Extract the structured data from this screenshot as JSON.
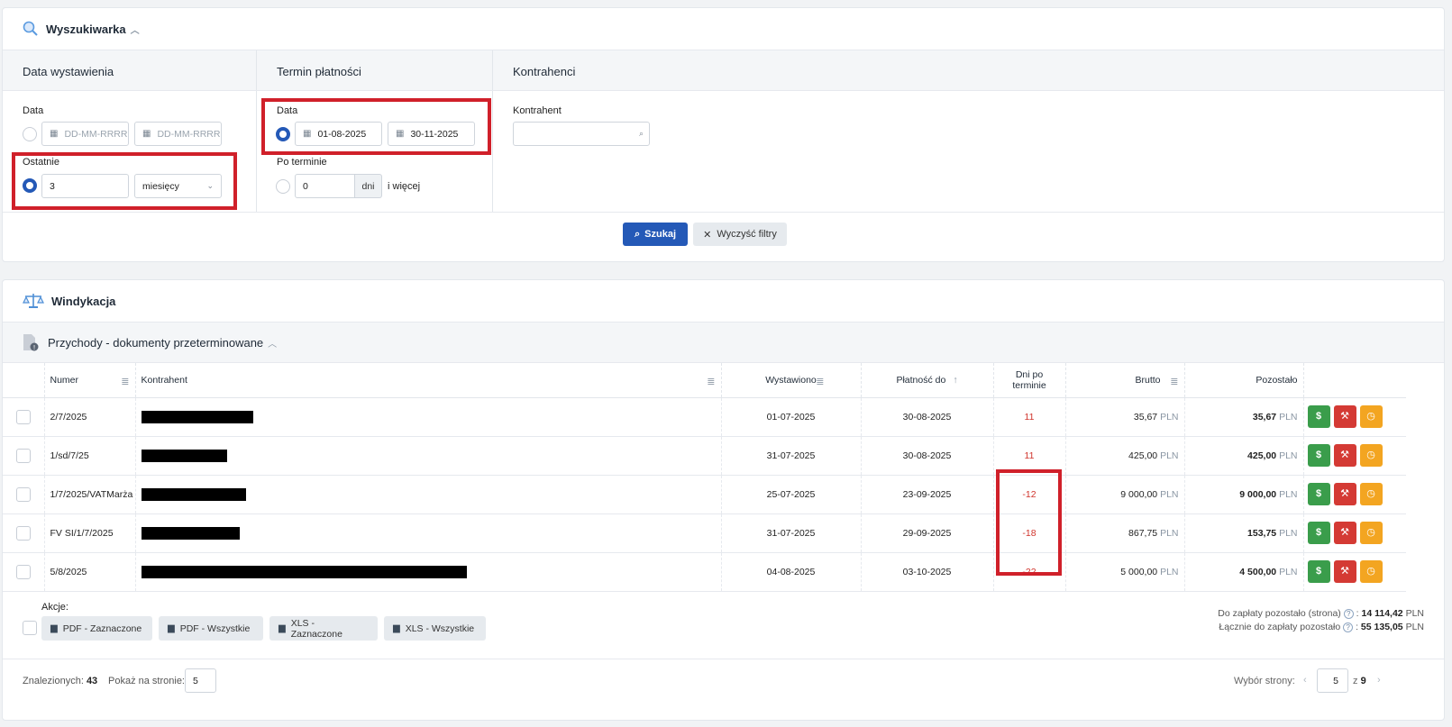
{
  "search": {
    "title": "Wyszukiwarka",
    "col1": {
      "title": "Data wystawienia",
      "date_label": "Data",
      "date_from_placeholder": "DD-MM-RRRR",
      "date_to_placeholder": "DD-MM-RRRR",
      "last_label": "Ostatnie",
      "last_value": "3",
      "last_unit": "miesięcy"
    },
    "col2": {
      "title": "Termin płatności",
      "date_label": "Data",
      "date_from": "01-08-2025",
      "date_to": "30-11-2025",
      "overdue_label": "Po terminie",
      "overdue_value": "0",
      "overdue_unit": "dni",
      "overdue_suffix": "i więcej"
    },
    "col3": {
      "title": "Kontrahenci",
      "contractor_label": "Kontrahent"
    },
    "search_button": "Szukaj",
    "clear_button": "Wyczyść filtry"
  },
  "windykacja": {
    "title": "Windykacja",
    "section_title": "Przychody - dokumenty przeterminowane",
    "columns": [
      "Numer",
      "Kontrahent",
      "Wystawiono",
      "Płatność do",
      "Dni po terminie",
      "Brutto",
      "Pozostało"
    ],
    "rows": [
      {
        "numer": "2/7/2025",
        "redact_w": 124,
        "wystawiono": "01-07-2025",
        "platnosc": "30-08-2025",
        "dni": "11",
        "brutto": "35,67",
        "pozostalo": "35,67"
      },
      {
        "numer": "1/sd/7/25",
        "redact_w": 95,
        "wystawiono": "31-07-2025",
        "platnosc": "30-08-2025",
        "dni": "11",
        "brutto": "425,00",
        "pozostalo": "425,00"
      },
      {
        "numer": "1/7/2025/VATMarża",
        "redact_w": 116,
        "wystawiono": "25-07-2025",
        "platnosc": "23-09-2025",
        "dni": "-12",
        "brutto": "9 000,00",
        "pozostalo": "9 000,00"
      },
      {
        "numer": "FV SI/1/7/2025",
        "redact_w": 109,
        "wystawiono": "31-07-2025",
        "platnosc": "29-09-2025",
        "dni": "-18",
        "brutto": "867,75",
        "pozostalo": "153,75"
      },
      {
        "numer": "5/8/2025",
        "redact_w": 361,
        "wystawiono": "04-08-2025",
        "platnosc": "03-10-2025",
        "dni": "-22",
        "brutto": "5 000,00",
        "pozostalo": "4 500,00"
      }
    ],
    "currency": "PLN",
    "actions_label": "Akcje:",
    "action_buttons": [
      "PDF - Zaznaczone",
      "PDF - Wszystkie",
      "XLS - Zaznaczone",
      "XLS - Wszystkie"
    ],
    "sum_page_label": "Do zapłaty pozostało (strona)",
    "sum_page_value": "14 114,42",
    "sum_total_label": "Łącznie do zapłaty pozostało",
    "sum_total_value": "55 135,05",
    "found_label": "Znalezionych:",
    "found_value": "43",
    "per_page_label": "Pokaż na stronie:",
    "per_page_value": "5",
    "page_select_label": "Wybór strony:",
    "page_current": "5",
    "page_of": "z",
    "page_total": "9"
  }
}
